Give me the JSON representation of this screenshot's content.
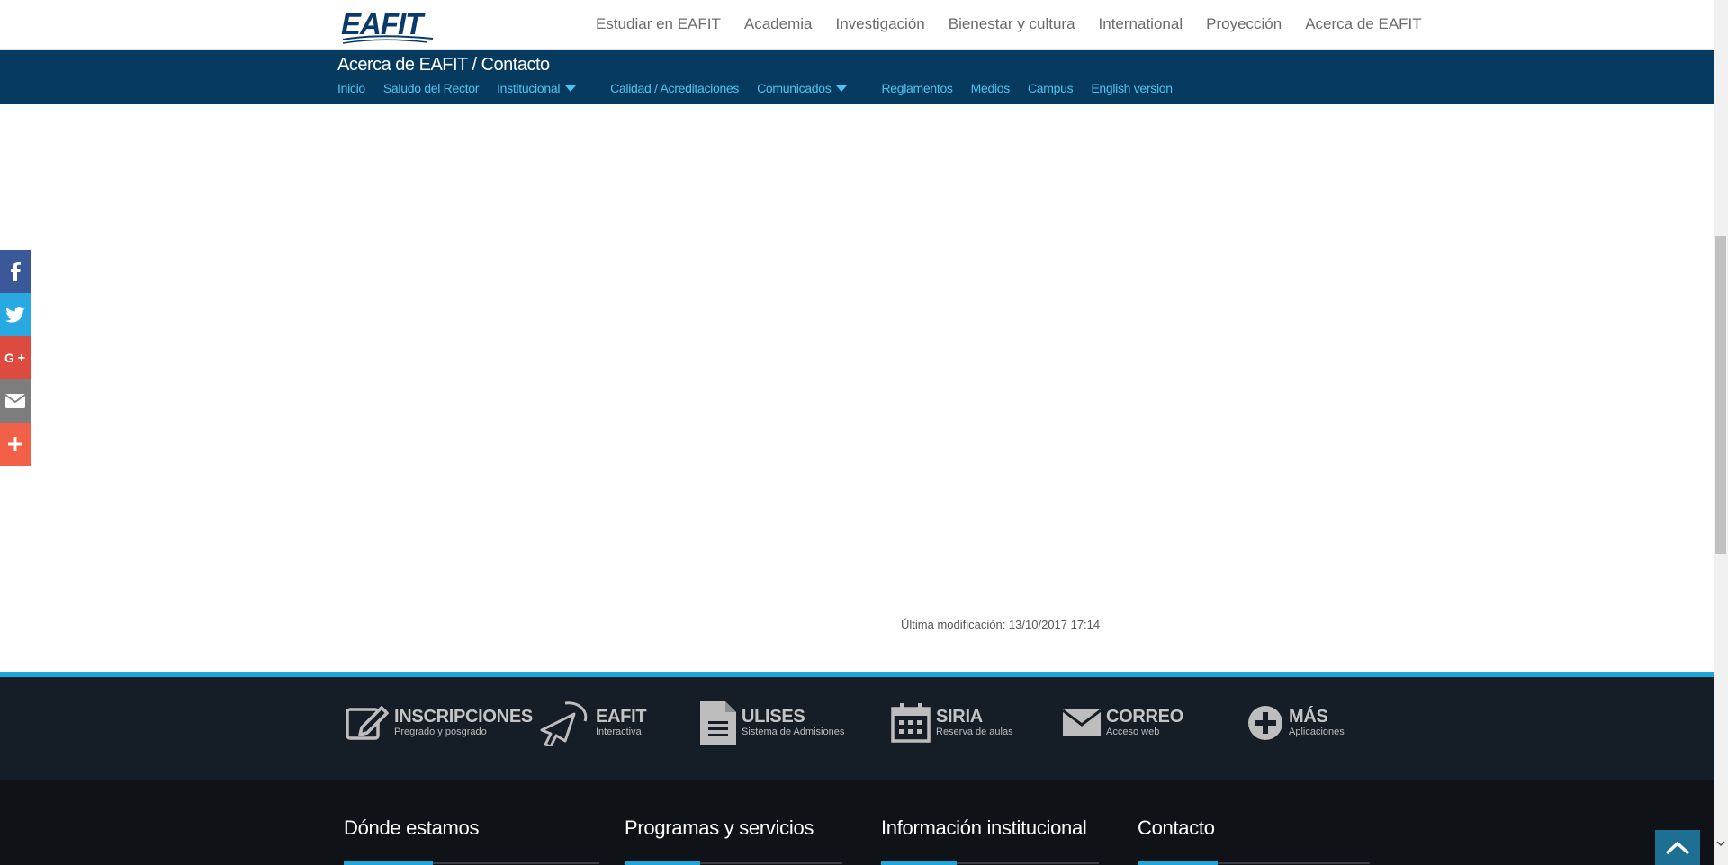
{
  "header": {
    "logo_text": "EAFIT",
    "nav": [
      {
        "label": "Estudiar en EAFIT"
      },
      {
        "label": "Academia"
      },
      {
        "label": "Investigación"
      },
      {
        "label": "Bienestar y cultura"
      },
      {
        "label": "International"
      },
      {
        "label": "Proyección"
      },
      {
        "label": "Acerca de EAFIT"
      }
    ]
  },
  "section": {
    "title": "Acerca de EAFIT / Contacto",
    "subnav": [
      {
        "label": "Inicio",
        "dropdown": false
      },
      {
        "label": "Saludo del Rector",
        "dropdown": false
      },
      {
        "label": "Institucional",
        "dropdown": true
      },
      {
        "label": "Calidad / Acreditaciones",
        "dropdown": false
      },
      {
        "label": "Comunicados",
        "dropdown": true
      },
      {
        "label": "Reglamentos",
        "dropdown": false
      },
      {
        "label": "Medios",
        "dropdown": false
      },
      {
        "label": "Campus",
        "dropdown": false
      },
      {
        "label": "English version",
        "dropdown": false
      }
    ]
  },
  "share": [
    {
      "name": "facebook-icon",
      "color": "#3b5998"
    },
    {
      "name": "twitter-icon",
      "color": "#29a9e1"
    },
    {
      "name": "google-plus-icon",
      "color": "#dc4b3e"
    },
    {
      "name": "email-icon",
      "color": "#7d7d7d"
    },
    {
      "name": "more-share-icon",
      "color": "#f26048"
    }
  ],
  "main": {
    "last_modified": "Última modificación: 13/10/2017 17:14"
  },
  "apps": [
    {
      "title": "INSCRIPCIONES",
      "subtitle": "Pregrado y posgrado",
      "icon": "edit-icon"
    },
    {
      "title": "EAFIT",
      "subtitle": "Interactiva",
      "icon": "cursor-icon"
    },
    {
      "title": "ULISES",
      "subtitle": "Sistema de Admisiones",
      "icon": "document-icon"
    },
    {
      "title": "SIRIA",
      "subtitle": "Reserva de aulas",
      "icon": "calendar-icon"
    },
    {
      "title": "CORREO",
      "subtitle": "Acceso web",
      "icon": "envelope-icon"
    },
    {
      "title": "MÁS",
      "subtitle": "Aplicaciones",
      "icon": "plus-circle-icon"
    }
  ],
  "footer": {
    "columns": [
      {
        "title": "Dónde estamos"
      },
      {
        "title": "Programas y servicios"
      },
      {
        "title": "Información institucional"
      },
      {
        "title": "Contacto"
      }
    ]
  },
  "colors": {
    "section_bar": "#063a5e",
    "link_accent": "#4ec3f3",
    "apps_bar": "#151d26",
    "footer": "#0f1216",
    "accent": "#1ea5d9"
  }
}
